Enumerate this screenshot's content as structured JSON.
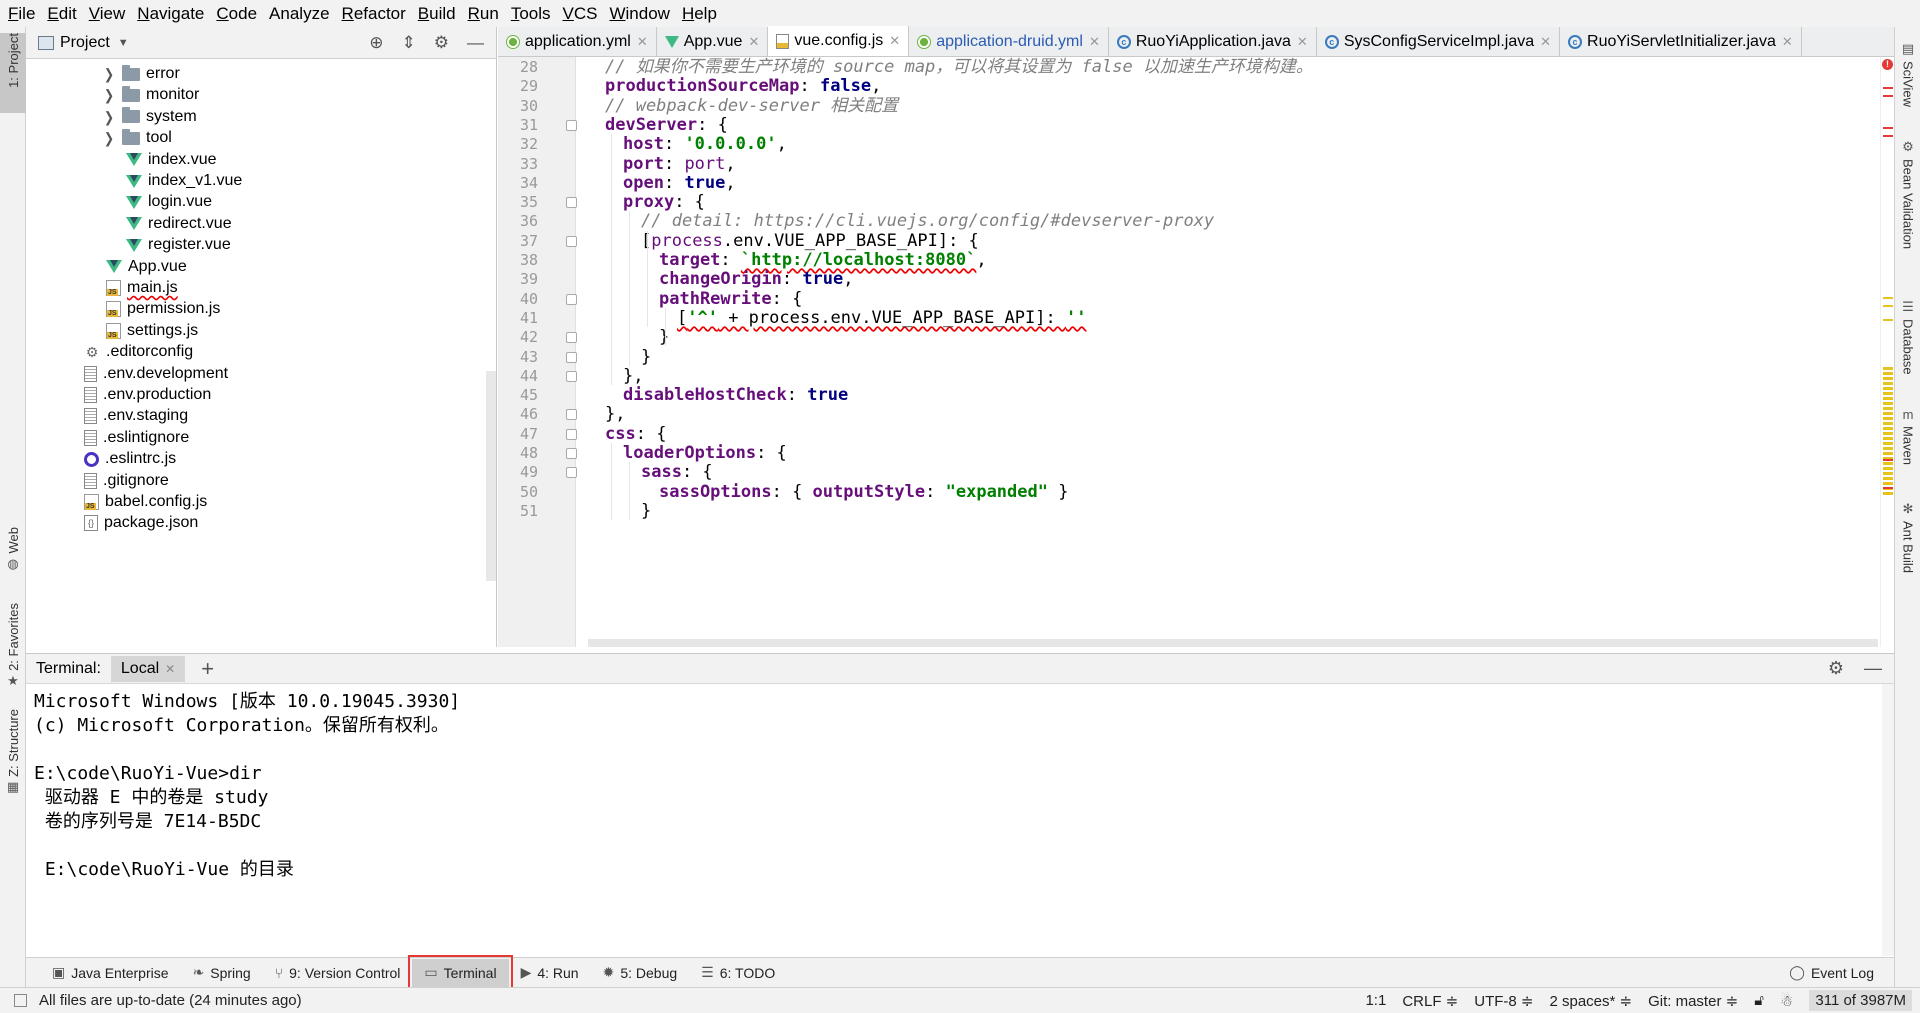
{
  "menu": [
    {
      "u": "F",
      "rest": "ile"
    },
    {
      "u": "E",
      "rest": "dit"
    },
    {
      "u": "V",
      "rest": "iew"
    },
    {
      "u": "N",
      "rest": "avigate"
    },
    {
      "u": "C",
      "rest": "ode"
    },
    {
      "u": "",
      "rest": "Analyze"
    },
    {
      "u": "R",
      "rest": "efactor"
    },
    {
      "u": "B",
      "rest": "uild"
    },
    {
      "u": "R",
      "rest": "un"
    },
    {
      "u": "T",
      "rest": "ools"
    },
    {
      "u": "V",
      "rest": "CS"
    },
    {
      "u": "W",
      "rest": "indow"
    },
    {
      "u": "H",
      "rest": "elp"
    }
  ],
  "left_stripe": {
    "project": "1: Project",
    "web": "Web",
    "favorites": "2: Favorites",
    "structure": "Z: Structure"
  },
  "right_stripe": {
    "sciview": "SciView",
    "bean": "Bean Validation",
    "database": "Database",
    "maven": "Maven",
    "ant": "Ant Build"
  },
  "project_panel": {
    "title": "Project",
    "tree": [
      {
        "label": "error",
        "type": "folder",
        "indent": 1,
        "arrow": true
      },
      {
        "label": "monitor",
        "type": "folder",
        "indent": 1,
        "arrow": true
      },
      {
        "label": "system",
        "type": "folder",
        "indent": 1,
        "arrow": true
      },
      {
        "label": "tool",
        "type": "folder",
        "indent": 1,
        "arrow": true
      },
      {
        "label": "index.vue",
        "type": "vue",
        "indent": 1,
        "arrow": false
      },
      {
        "label": "index_v1.vue",
        "type": "vue",
        "indent": 1,
        "arrow": false
      },
      {
        "label": "login.vue",
        "type": "vue",
        "indent": 1,
        "arrow": false
      },
      {
        "label": "redirect.vue",
        "type": "vue",
        "indent": 1,
        "arrow": false
      },
      {
        "label": "register.vue",
        "type": "vue",
        "indent": 1,
        "arrow": false
      },
      {
        "label": "App.vue",
        "type": "vue",
        "indent": 0,
        "arrow": false
      },
      {
        "label": "main.js",
        "type": "js",
        "indent": 0,
        "arrow": false,
        "squiggle": true
      },
      {
        "label": "permission.js",
        "type": "js",
        "indent": 0,
        "arrow": false
      },
      {
        "label": "settings.js",
        "type": "js",
        "indent": 0,
        "arrow": false
      },
      {
        "label": ".editorconfig",
        "type": "gear",
        "indent": -1,
        "arrow": false
      },
      {
        "label": ".env.development",
        "type": "file",
        "indent": -1,
        "arrow": false
      },
      {
        "label": ".env.production",
        "type": "file",
        "indent": -1,
        "arrow": false
      },
      {
        "label": ".env.staging",
        "type": "file",
        "indent": -1,
        "arrow": false
      },
      {
        "label": ".eslintignore",
        "type": "file",
        "indent": -1,
        "arrow": false
      },
      {
        "label": ".eslintrc.js",
        "type": "circle",
        "indent": -1,
        "arrow": false
      },
      {
        "label": ".gitignore",
        "type": "file",
        "indent": -1,
        "arrow": false
      },
      {
        "label": "babel.config.js",
        "type": "js",
        "indent": -1,
        "arrow": false
      },
      {
        "label": "package.json",
        "type": "json",
        "indent": -1,
        "arrow": false
      }
    ]
  },
  "editor": {
    "tabs": [
      {
        "label": "application.yml",
        "icon": "yml",
        "active": false,
        "blue": false
      },
      {
        "label": "App.vue",
        "icon": "vue",
        "active": false,
        "blue": false
      },
      {
        "label": "vue.config.js",
        "icon": "js",
        "active": true,
        "blue": false
      },
      {
        "label": "application-druid.yml",
        "icon": "yml",
        "active": false,
        "blue": true
      },
      {
        "label": "RuoYiApplication.java",
        "icon": "java",
        "active": false,
        "blue": false
      },
      {
        "label": "SysConfigServiceImpl.java",
        "icon": "java",
        "active": false,
        "blue": false
      },
      {
        "label": "RuoYiServletInitializer.java",
        "icon": "java",
        "active": false,
        "blue": false
      }
    ],
    "lines": [
      {
        "n": "28",
        "indent": 0,
        "parts": [
          [
            "c",
            "// 如果你不需要生产环境的 source map，可以将其设置为 false 以加速生产环境构建。"
          ]
        ]
      },
      {
        "n": "29",
        "indent": 0,
        "parts": [
          [
            "p",
            "productionSourceMap"
          ],
          [
            "",
            ": "
          ],
          [
            "k",
            "false"
          ],
          [
            "",
            ","
          ]
        ]
      },
      {
        "n": "30",
        "indent": 0,
        "parts": [
          [
            "c",
            "// webpack-dev-server 相关配置"
          ]
        ]
      },
      {
        "n": "31",
        "indent": 0,
        "fold": true,
        "parts": [
          [
            "p",
            "devServer"
          ],
          [
            "",
            ": {"
          ]
        ]
      },
      {
        "n": "32",
        "indent": 1,
        "parts": [
          [
            "p",
            "host"
          ],
          [
            "",
            ": "
          ],
          [
            "s",
            "'0.0.0.0'"
          ],
          [
            "",
            ","
          ]
        ]
      },
      {
        "n": "33",
        "indent": 1,
        "parts": [
          [
            "p",
            "port"
          ],
          [
            "",
            ": "
          ],
          [
            "pn",
            "port"
          ],
          [
            "",
            ","
          ]
        ]
      },
      {
        "n": "34",
        "indent": 1,
        "parts": [
          [
            "p",
            "open"
          ],
          [
            "",
            ": "
          ],
          [
            "k",
            "true"
          ],
          [
            "",
            ","
          ]
        ]
      },
      {
        "n": "35",
        "indent": 1,
        "fold": true,
        "parts": [
          [
            "p",
            "proxy"
          ],
          [
            "",
            ": {"
          ]
        ]
      },
      {
        "n": "36",
        "indent": 2,
        "parts": [
          [
            "c",
            "// detail: https://cli.vuejs.org/config/#devserver-proxy"
          ]
        ]
      },
      {
        "n": "37",
        "indent": 2,
        "fold": true,
        "parts": [
          [
            "",
            "["
          ],
          [
            "pn",
            "process"
          ],
          [
            "",
            ".env.VUE_APP_BASE_API]: {"
          ]
        ]
      },
      {
        "n": "38",
        "indent": 3,
        "parts": [
          [
            "p",
            "target"
          ],
          [
            "",
            ": "
          ],
          [
            "s",
            "`http://localhost:8080`"
          ],
          [
            "",
            ","
          ]
        ]
      },
      {
        "n": "39",
        "indent": 3,
        "parts": [
          [
            "p",
            "changeOrigin"
          ],
          [
            "",
            ": "
          ],
          [
            "k",
            "true"
          ],
          [
            "",
            ","
          ]
        ]
      },
      {
        "n": "40",
        "indent": 3,
        "fold": true,
        "parts": [
          [
            "p",
            "pathRewrite"
          ],
          [
            "",
            ": {"
          ]
        ]
      },
      {
        "n": "41",
        "indent": 4,
        "parts": [
          [
            "",
            "["
          ],
          [
            "s",
            "'^'"
          ],
          [
            "",
            " + process.env.VUE_APP_BASE_API]: "
          ],
          [
            "s",
            "''"
          ]
        ]
      },
      {
        "n": "42",
        "indent": 3,
        "fold": true,
        "parts": [
          [
            "",
            "}"
          ]
        ]
      },
      {
        "n": "43",
        "indent": 2,
        "fold": true,
        "parts": [
          [
            "",
            "}"
          ]
        ]
      },
      {
        "n": "44",
        "indent": 1,
        "fold": true,
        "parts": [
          [
            "",
            "},"
          ]
        ]
      },
      {
        "n": "45",
        "indent": 1,
        "parts": [
          [
            "p",
            "disableHostCheck"
          ],
          [
            "",
            ": "
          ],
          [
            "k",
            "true"
          ]
        ]
      },
      {
        "n": "46",
        "indent": 0,
        "fold": true,
        "parts": [
          [
            "",
            "},"
          ]
        ]
      },
      {
        "n": "47",
        "indent": 0,
        "fold": true,
        "parts": [
          [
            "p",
            "css"
          ],
          [
            "",
            ": {"
          ]
        ]
      },
      {
        "n": "48",
        "indent": 1,
        "fold": true,
        "parts": [
          [
            "p",
            "loaderOptions"
          ],
          [
            "",
            ": {"
          ]
        ]
      },
      {
        "n": "49",
        "indent": 2,
        "fold": true,
        "parts": [
          [
            "p",
            "sass"
          ],
          [
            "",
            ": {"
          ]
        ]
      },
      {
        "n": "50",
        "indent": 3,
        "parts": [
          [
            "p",
            "sassOptions"
          ],
          [
            "",
            ": { "
          ],
          [
            "p",
            "outputStyle"
          ],
          [
            "",
            ": "
          ],
          [
            "s",
            "\"expanded\""
          ],
          [
            "",
            " }"
          ]
        ]
      },
      {
        "n": "51",
        "indent": 2,
        "parts": [
          [
            "",
            "}"
          ]
        ]
      }
    ]
  },
  "terminal": {
    "title": "Terminal:",
    "tab": "Local",
    "lines": [
      "Microsoft Windows [版本 10.0.19045.3930]",
      "(c) Microsoft Corporation。保留所有权利。",
      "",
      "E:\\code\\RuoYi-Vue>dir",
      " 驱动器 E 中的卷是 study",
      " 卷的序列号是 7E14-B5DC",
      "",
      " E:\\code\\RuoYi-Vue 的目录"
    ]
  },
  "bottom_tabs": [
    {
      "label": "Java Enterprise",
      "icon": "▣",
      "active": false
    },
    {
      "label": "Spring",
      "icon": "❧",
      "active": false
    },
    {
      "label": "9: Version Control",
      "icon": "⑂",
      "active": false
    },
    {
      "label": "Terminal",
      "icon": "▭",
      "active": true
    },
    {
      "label": "4: Run",
      "icon": "▶",
      "active": false
    },
    {
      "label": "5: Debug",
      "icon": "✹",
      "active": false
    },
    {
      "label": "6: TODO",
      "icon": "☰",
      "active": false
    }
  ],
  "event_log": "Event Log",
  "status": {
    "message": "All files are up-to-date (24 minutes ago)",
    "position": "1:1",
    "line_sep": "CRLF ≑",
    "encoding": "UTF-8 ≑",
    "indent": "2 spaces* ≑",
    "git": "Git: master ≑",
    "memory": "311 of 3987M"
  }
}
